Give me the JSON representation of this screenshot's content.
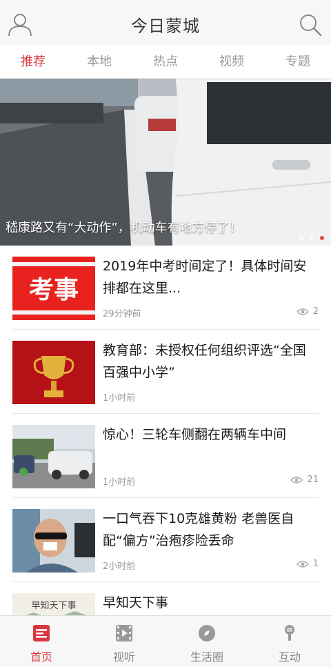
{
  "header": {
    "title": "今日蒙城"
  },
  "tabs": [
    {
      "label": "推荐",
      "active": true
    },
    {
      "label": "本地",
      "active": false
    },
    {
      "label": "热点",
      "active": false
    },
    {
      "label": "视频",
      "active": false
    },
    {
      "label": "专题",
      "active": false
    }
  ],
  "banner": {
    "caption": "嵇康路又有“大动作”，机动车有地方停了！",
    "slide_count": 3,
    "active_slide": 3
  },
  "news": [
    {
      "headline": "2019年中考时间定了！具体时间安排都在这里...",
      "time": "29分钟前",
      "views": "2",
      "thumb_text": "考事"
    },
    {
      "headline": "教育部：未授权任何组织评选“全国百强中小学”",
      "time": "1小时前",
      "views": null
    },
    {
      "headline": "惊心！三轮车侧翻在两辆车中间",
      "time": "1小时前",
      "views": "21"
    },
    {
      "headline": "一口气吞下10克雄黄粉 老兽医自配“偏方”治疱疹险丢命",
      "time": "2小时前",
      "views": "1"
    },
    {
      "headline": "早知天下事",
      "time": "",
      "views": null,
      "thumb_text": "早知天下事"
    }
  ],
  "bottom_nav": [
    {
      "label": "首页",
      "icon": "home-news-icon",
      "active": true
    },
    {
      "label": "视听",
      "icon": "video-film-icon",
      "active": false
    },
    {
      "label": "生活圈",
      "icon": "compass-icon",
      "active": false
    },
    {
      "label": "互动",
      "icon": "microphone-icon",
      "active": false
    }
  ],
  "colors": {
    "accent": "#d9363e",
    "header_bg": "#f7f7f7",
    "muted": "#999999"
  }
}
